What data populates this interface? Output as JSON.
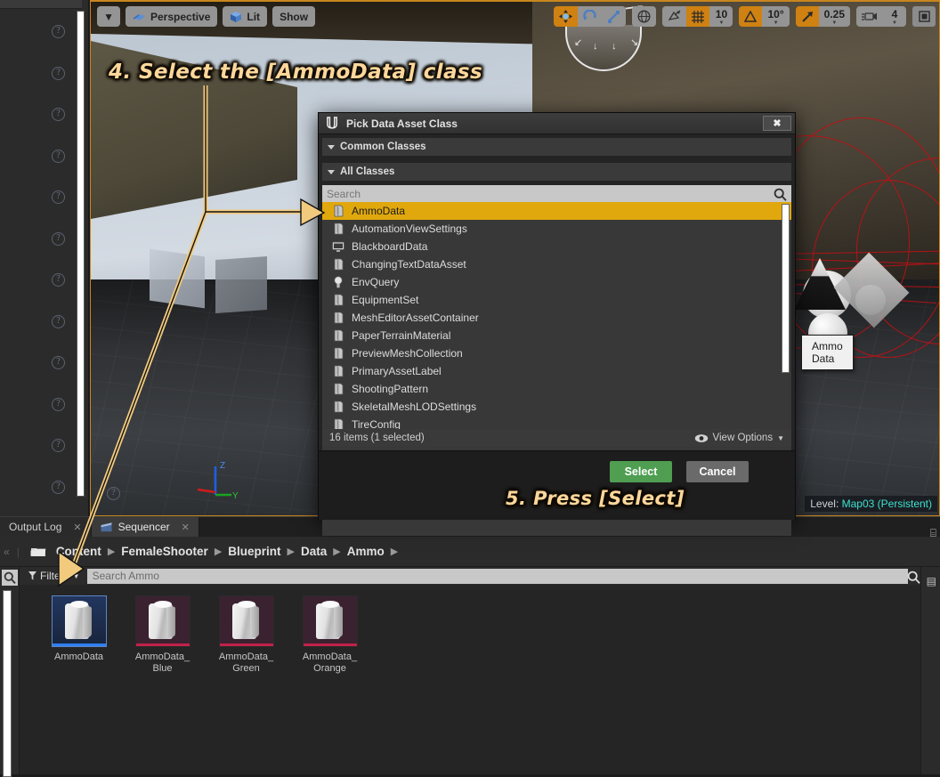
{
  "viewport": {
    "toolbar_left": [
      {
        "name": "viewport-menu",
        "label": "",
        "icon": "chevron-down-icon"
      },
      {
        "name": "perspective",
        "label": "Perspective",
        "icon": "perspective-icon"
      },
      {
        "name": "lit",
        "label": "Lit",
        "icon": "cube-icon"
      },
      {
        "name": "show",
        "label": "Show",
        "icon": ""
      }
    ],
    "toolbar_right": {
      "move_icon": "move-tool-icon",
      "rotate_icon": "rotate-tool-icon",
      "scale_icon": "scale-tool-icon",
      "world_icon": "globe-icon",
      "surface_snap_icon": "surface-snap-icon",
      "grid_icon": "grid-snap-icon",
      "grid_value": "10",
      "angle_icon": "angle-snap-icon",
      "angle_value": "10°",
      "scale_snap_icon": "scale-snap-icon",
      "scale_value": "0.25",
      "camera_icon": "camera-speed-icon",
      "camera_value": "4",
      "maximize_icon": "maximize-viewport-icon"
    },
    "axis_labels": {
      "z": "Z",
      "y": "Y",
      "x": ""
    },
    "level": {
      "label": "Level:",
      "value": "Map03 (Persistent)"
    }
  },
  "annotations": {
    "step4": "4. Select the [AmmoData] class",
    "step5": "5. Press [Select]"
  },
  "dialog": {
    "title": "Pick Data Asset Class",
    "close_label": "✖",
    "sections": [
      {
        "name": "common-classes",
        "label": "Common Classes"
      },
      {
        "name": "all-classes",
        "label": "All Classes"
      }
    ],
    "search_placeholder": "Search",
    "search_value": "",
    "classes": [
      {
        "name": "AmmoData",
        "icon": "data-asset-icon",
        "selected": true
      },
      {
        "name": "AutomationViewSettings",
        "icon": "data-asset-icon",
        "selected": false
      },
      {
        "name": "BlackboardData",
        "icon": "blackboard-icon",
        "selected": false
      },
      {
        "name": "ChangingTextDataAsset",
        "icon": "data-asset-icon",
        "selected": false
      },
      {
        "name": "EnvQuery",
        "icon": "envquery-icon",
        "selected": false
      },
      {
        "name": "EquipmentSet",
        "icon": "data-asset-icon",
        "selected": false
      },
      {
        "name": "MeshEditorAssetContainer",
        "icon": "data-asset-icon",
        "selected": false
      },
      {
        "name": "PaperTerrainMaterial",
        "icon": "data-asset-icon",
        "selected": false
      },
      {
        "name": "PreviewMeshCollection",
        "icon": "data-asset-icon",
        "selected": false
      },
      {
        "name": "PrimaryAssetLabel",
        "icon": "data-asset-icon",
        "selected": false
      },
      {
        "name": "ShootingPattern",
        "icon": "data-asset-icon",
        "selected": false
      },
      {
        "name": "SkeletalMeshLODSettings",
        "icon": "data-asset-icon",
        "selected": false
      },
      {
        "name": "TireConfig",
        "icon": "data-asset-icon",
        "selected": false
      }
    ],
    "tooltip": "Ammo Data",
    "status": "16 items (1 selected)",
    "view_options": "View Options",
    "buttons": {
      "select": "Select",
      "cancel": "Cancel"
    },
    "colors": {
      "selection": "#e0a80d",
      "select_button": "#4f9e52",
      "cancel_button": "#6a6a6a"
    }
  },
  "bottom_panel": {
    "tabs": [
      {
        "name": "output-log",
        "label": "Output Log",
        "active": false,
        "icon": ""
      },
      {
        "name": "sequencer",
        "label": "Sequencer",
        "active": true,
        "icon": "clapperboard-icon"
      }
    ],
    "breadcrumb": [
      "Content",
      "FemaleShooter",
      "Blueprint",
      "Data",
      "Ammo"
    ],
    "filters_label": "Filters",
    "search_placeholder": "Search Ammo",
    "search_value": "",
    "assets": [
      {
        "label": "AmmoData",
        "selected": true,
        "bar_color": "#2f7ff0"
      },
      {
        "label": "AmmoData_\nBlue",
        "selected": false,
        "bar_color": "#c0224a"
      },
      {
        "label": "AmmoData_\nGreen",
        "selected": false,
        "bar_color": "#c0224a"
      },
      {
        "label": "AmmoData_\nOrange",
        "selected": false,
        "bar_color": "#c0224a"
      }
    ]
  }
}
